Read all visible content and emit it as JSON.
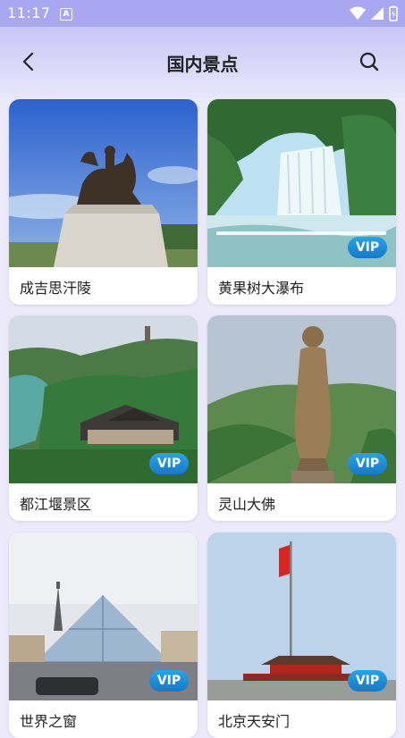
{
  "status": {
    "time": "11:17",
    "a_badge": "A"
  },
  "header": {
    "title": "国内景点"
  },
  "cards": [
    {
      "label": "成吉思汗陵",
      "vip": ""
    },
    {
      "label": "黄果树大瀑布",
      "vip": "VIP"
    },
    {
      "label": "都江堰景区",
      "vip": "VIP"
    },
    {
      "label": "灵山大佛",
      "vip": "VIP"
    },
    {
      "label": "世界之窗",
      "vip": "VIP"
    },
    {
      "label": "北京天安门",
      "vip": "VIP"
    }
  ],
  "colors": {
    "accent": "#1a8ad8",
    "header": "#c9c6f7"
  }
}
